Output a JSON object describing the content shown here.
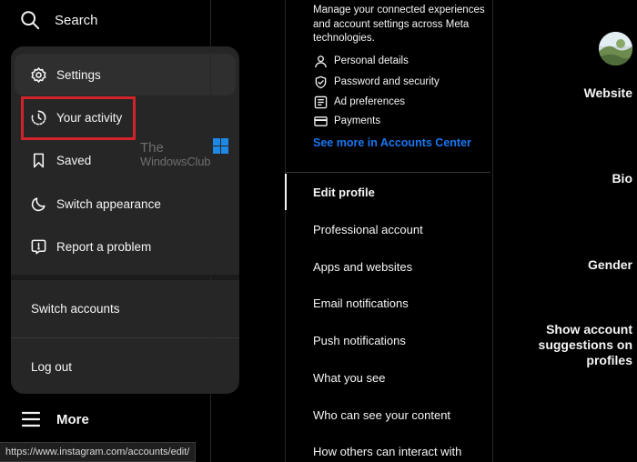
{
  "sidebar": {
    "search_label": "Search",
    "more_label": "More"
  },
  "more_menu": {
    "items": [
      {
        "label": "Settings",
        "icon": "gear-icon"
      },
      {
        "label": "Your activity",
        "icon": "activity-icon"
      },
      {
        "label": "Saved",
        "icon": "bookmark-icon"
      },
      {
        "label": "Switch appearance",
        "icon": "moon-icon"
      },
      {
        "label": "Report a problem",
        "icon": "report-icon"
      }
    ],
    "switch_accounts": "Switch accounts",
    "log_out": "Log out",
    "highlight_color": "#d1232a"
  },
  "watermark": {
    "line1": "The",
    "line2": "WindowsClub"
  },
  "status_url": "https://www.instagram.com/accounts/edit/",
  "accounts_center": {
    "description": "Manage your connected experiences and account settings across Meta technologies.",
    "links": [
      {
        "label": "Personal details",
        "icon": "person-icon"
      },
      {
        "label": "Password and security",
        "icon": "shield-icon"
      },
      {
        "label": "Ad preferences",
        "icon": "ad-icon"
      },
      {
        "label": "Payments",
        "icon": "card-icon"
      }
    ],
    "see_more": "See more in Accounts Center",
    "link_color": "#1877f2"
  },
  "settings_nav": {
    "items": [
      {
        "label": "Edit profile",
        "active": true
      },
      {
        "label": "Professional account"
      },
      {
        "label": "Apps and websites"
      },
      {
        "label": "Email notifications"
      },
      {
        "label": "Push notifications"
      },
      {
        "label": "What you see"
      },
      {
        "label": "Who can see your content"
      },
      {
        "label": "How others can interact with"
      }
    ]
  },
  "profile_form": {
    "fields": [
      "Website",
      "Bio",
      "Gender",
      "Show account suggestions on profiles"
    ]
  }
}
